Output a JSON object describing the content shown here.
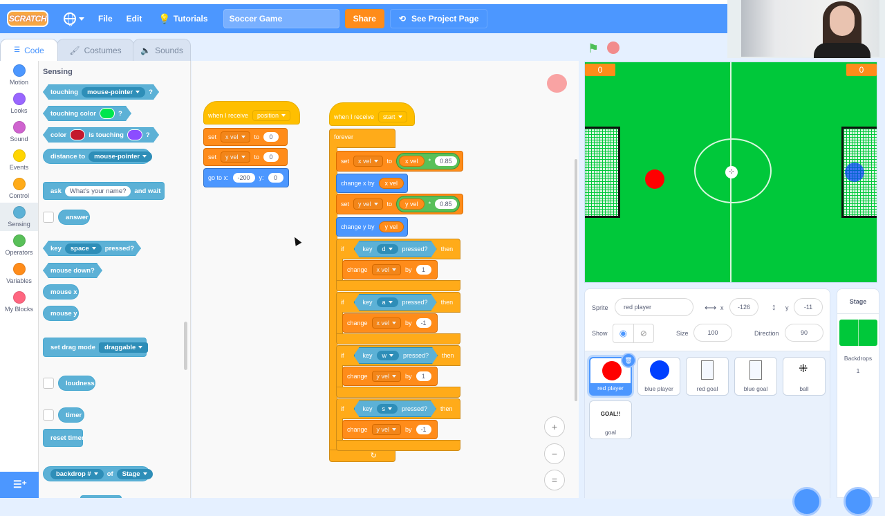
{
  "menubar": {
    "logo": "SCRATCH",
    "file": "File",
    "edit": "Edit",
    "tutorials": "Tutorials",
    "project_title": "Soccer Game",
    "share": "Share",
    "see_project_page": "See Project Page"
  },
  "tabs": [
    {
      "label": "Code",
      "active": true
    },
    {
      "label": "Costumes",
      "active": false
    },
    {
      "label": "Sounds",
      "active": false
    }
  ],
  "categories": [
    {
      "label": "Motion",
      "color": "#4c97ff"
    },
    {
      "label": "Looks",
      "color": "#9966ff"
    },
    {
      "label": "Sound",
      "color": "#cf63cf"
    },
    {
      "label": "Events",
      "color": "#ffd500"
    },
    {
      "label": "Control",
      "color": "#ffab19"
    },
    {
      "label": "Sensing",
      "color": "#5cb1d6",
      "selected": true
    },
    {
      "label": "Operators",
      "color": "#59c059"
    },
    {
      "label": "Variables",
      "color": "#ff8c1a"
    },
    {
      "label": "My Blocks",
      "color": "#ff6680"
    }
  ],
  "palette": {
    "title": "Sensing",
    "touching": {
      "label": "touching",
      "menu": "mouse-pointer",
      "q": "?"
    },
    "touching_color": {
      "label": "touching color",
      "q": "?",
      "swatch": "#00e64d"
    },
    "color_touching": {
      "label1": "color",
      "label2": "is touching",
      "q": "?",
      "swatch1": "#c3192e",
      "swatch2": "#8c4dff"
    },
    "distance": {
      "label": "distance to",
      "menu": "mouse-pointer"
    },
    "ask": {
      "label1": "ask",
      "input": "What's your name?",
      "label2": "and wait"
    },
    "answer": "answer",
    "key_pressed": {
      "label1": "key",
      "menu": "space",
      "label2": "pressed?"
    },
    "mouse_down": "mouse down?",
    "mouse_x": "mouse x",
    "mouse_y": "mouse y",
    "drag_mode": {
      "label": "set drag mode",
      "menu": "draggable"
    },
    "loudness": "loudness",
    "timer": "timer",
    "reset_timer": "reset timer",
    "backdrop_of": {
      "menu1": "backdrop #",
      "label": "of",
      "menu2": "Stage"
    }
  },
  "script1": {
    "hat": {
      "label": "when I receive",
      "menu": "position"
    },
    "set_x": {
      "label": "set",
      "var": "x vel",
      "to": "to",
      "value": "0"
    },
    "set_y": {
      "label": "set",
      "var": "y vel",
      "to": "to",
      "value": "0"
    },
    "goto": {
      "label": "go to x:",
      "x": "-200",
      "ylabel": "y:",
      "y": "0"
    }
  },
  "script2": {
    "hat": {
      "label": "when I receive",
      "menu": "start"
    },
    "forever": "forever",
    "set_xvel": {
      "label": "set",
      "var": "x vel",
      "to": "to",
      "op_var": "x vel",
      "op": "*",
      "value": "0.85"
    },
    "change_x": {
      "label": "change x by",
      "var": "x vel"
    },
    "set_yvel": {
      "label": "set",
      "var": "y vel",
      "to": "to",
      "op_var": "y vel",
      "op": "*",
      "value": "0.85"
    },
    "change_y": {
      "label": "change y by",
      "var": "y vel"
    },
    "ifs": [
      {
        "if": "if",
        "key": "key",
        "keyname": "d",
        "pressed": "pressed?",
        "then": "then",
        "change": "change",
        "var": "x vel",
        "by": "by",
        "value": "1"
      },
      {
        "if": "if",
        "key": "key",
        "keyname": "a",
        "pressed": "pressed?",
        "then": "then",
        "change": "change",
        "var": "x vel",
        "by": "by",
        "value": "-1"
      },
      {
        "if": "if",
        "key": "key",
        "keyname": "w",
        "pressed": "pressed?",
        "then": "then",
        "change": "change",
        "var": "y vel",
        "by": "by",
        "value": "1"
      },
      {
        "if": "if",
        "key": "key",
        "keyname": "s",
        "pressed": "pressed?",
        "then": "then",
        "change": "change",
        "var": "y vel",
        "by": "by",
        "value": "-1"
      }
    ]
  },
  "zoom": {
    "in": "+",
    "out": "−",
    "reset": "="
  },
  "stage": {
    "score_left": "0",
    "score_right": "0"
  },
  "sprite_info": {
    "sprite_label": "Sprite",
    "sprite_name": "red player",
    "x_label": "x",
    "x": "-126",
    "y_label": "y",
    "y": "-11",
    "show_label": "Show",
    "size_label": "Size",
    "size": "100",
    "direction_label": "Direction",
    "direction": "90"
  },
  "sprites": [
    {
      "name": "red player",
      "selected": true
    },
    {
      "name": "blue player"
    },
    {
      "name": "red goal"
    },
    {
      "name": "blue goal"
    },
    {
      "name": "ball"
    },
    {
      "name": "goal",
      "thumb_text": "GOAL!!"
    }
  ],
  "stage_panel": {
    "title": "Stage",
    "backdrops_label": "Backdrops",
    "backdrops_count": "1"
  }
}
